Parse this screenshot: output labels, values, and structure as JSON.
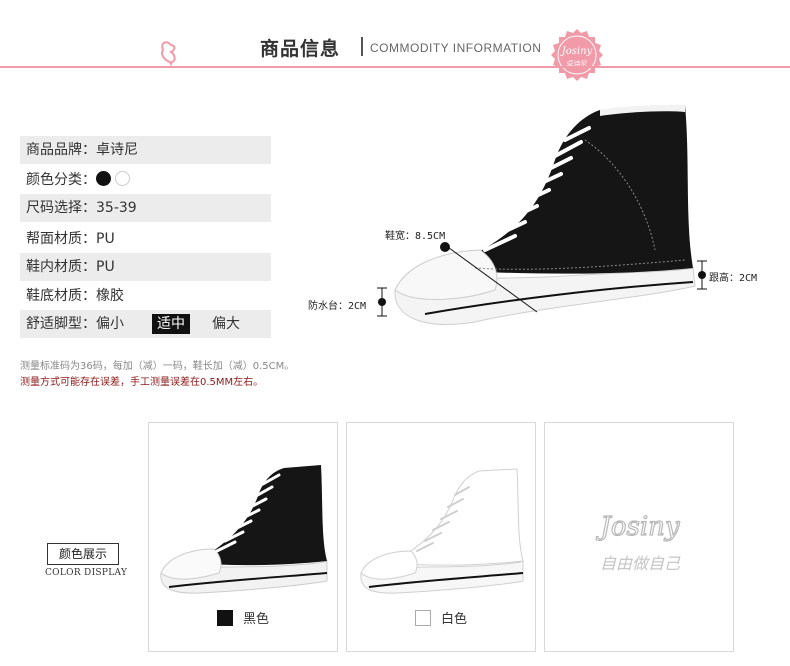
{
  "header": {
    "title_cn": "商品信息",
    "title_en": "COMMODITY INFORMATION",
    "seal_text": "卓诗尼",
    "seal_logo": "Josiny"
  },
  "specs": [
    {
      "label": "商品品牌：",
      "value": "卓诗尼"
    },
    {
      "label": "颜色分类：",
      "value": ""
    },
    {
      "label": "尺码选择：",
      "value": "35-39"
    },
    {
      "label": "帮面材质：",
      "value": "PU"
    },
    {
      "label": "鞋内材质：",
      "value": "PU"
    },
    {
      "label": "鞋底材质：",
      "value": "橡胶"
    },
    {
      "label": "舒适脚型：",
      "value": ""
    }
  ],
  "fit_options": [
    "偏小",
    "适中",
    "偏大"
  ],
  "fit_selected": "适中",
  "notes": {
    "line1": "测量标准码为36码，每加（减）一码，鞋长加（减）0.5CM。",
    "line2": "测量方式可能存在误差，手工测量误差在0.5MM左右。"
  },
  "dimensions": {
    "width": "鞋宽：8.5CM",
    "heel": "跟高：2CM",
    "platform": "防水台：2CM"
  },
  "color_display": {
    "label_cn": "颜色展示",
    "label_en": "COLOR DISPLAY",
    "colors": [
      {
        "name": "黑色",
        "swatch": "#111111"
      },
      {
        "name": "白色",
        "swatch": "#ffffff"
      }
    ],
    "watermark_logo": "Josiny",
    "watermark_script": "自由做自己"
  },
  "colors": {
    "accent_pink": "#f19aa8",
    "note_red": "#8b1a1a"
  }
}
